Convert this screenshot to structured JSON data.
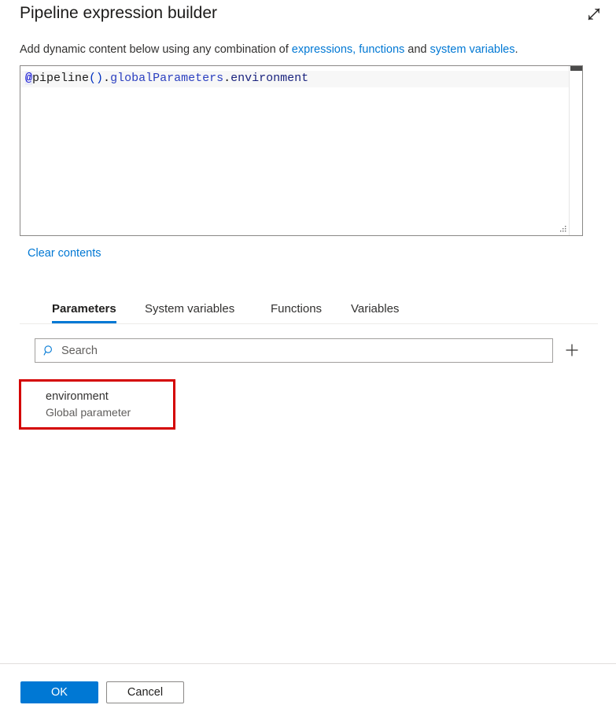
{
  "header": {
    "title": "Pipeline expression builder",
    "expand_icon": "expand-diagonal-icon"
  },
  "subtitle": {
    "prefix": "Add dynamic content below using any combination of ",
    "link_expressions": "expressions, functions",
    "middle": " and ",
    "link_system_variables": "system variables",
    "suffix": "."
  },
  "editor": {
    "expression": "@pipeline().globalParameters.environment",
    "tokens": {
      "at": "@",
      "func": "pipeline",
      "parens": "()",
      "dot1": ".",
      "prop": "globalParameters",
      "dot2": ".",
      "member": "environment"
    },
    "scrollbar": "vertical-scrollbar",
    "resize_grip": "resize-grip-icon"
  },
  "clear_link": "Clear contents",
  "tabs": [
    {
      "label": "Parameters",
      "active": true
    },
    {
      "label": "System variables",
      "active": false
    },
    {
      "label": "Functions",
      "active": false
    },
    {
      "label": "Variables",
      "active": false
    }
  ],
  "search": {
    "placeholder": "Search",
    "value": "",
    "icon": "search-icon",
    "add_icon": "plus-icon"
  },
  "parameters": [
    {
      "name": "environment",
      "type": "Global parameter"
    }
  ],
  "footer": {
    "ok_label": "OK",
    "cancel_label": "Cancel"
  },
  "colors": {
    "accent": "#0078d4",
    "link": "#0078d4",
    "annotation": "#d40000",
    "text": "#323130",
    "secondary_text": "#605e5c",
    "border": "#8a8886"
  }
}
